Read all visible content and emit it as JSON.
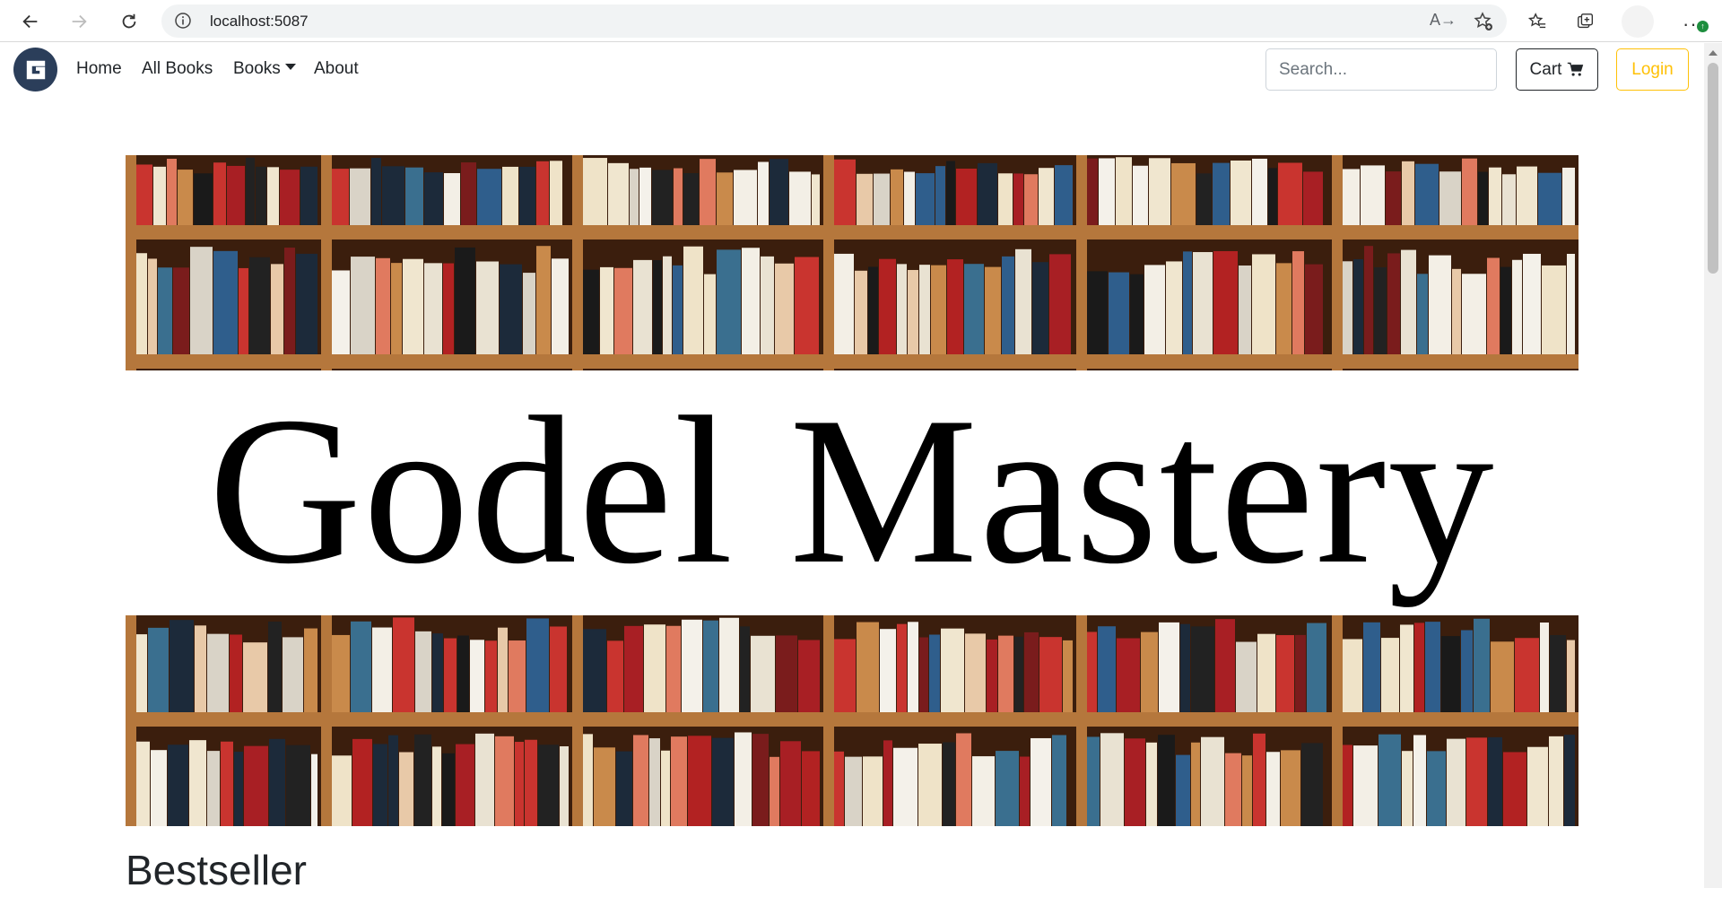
{
  "browser": {
    "url": "localhost:5087",
    "read_aloud_label": "A→"
  },
  "navbar": {
    "links": [
      {
        "label": "Home"
      },
      {
        "label": "All Books"
      },
      {
        "label": "Books"
      },
      {
        "label": "About"
      }
    ],
    "search_placeholder": "Search...",
    "cart_label": "Cart",
    "login_label": "Login"
  },
  "hero": {
    "title": "Godel Mastery"
  },
  "sections": {
    "bestseller_title": "Bestseller"
  },
  "colors": {
    "login_accent": "#ffc107",
    "brand_circle": "#2b3e5a",
    "shelf_wood": "#b5773c",
    "shelf_back": "#3b1e0d"
  },
  "icons": [
    "back-arrow-icon",
    "forward-arrow-icon",
    "reload-icon",
    "info-icon",
    "read-aloud-icon",
    "add-favorite-icon",
    "favorites-icon",
    "collections-icon",
    "profile-icon",
    "more-icon",
    "brand-logo-icon",
    "caret-down-icon",
    "shopping-cart-icon"
  ]
}
